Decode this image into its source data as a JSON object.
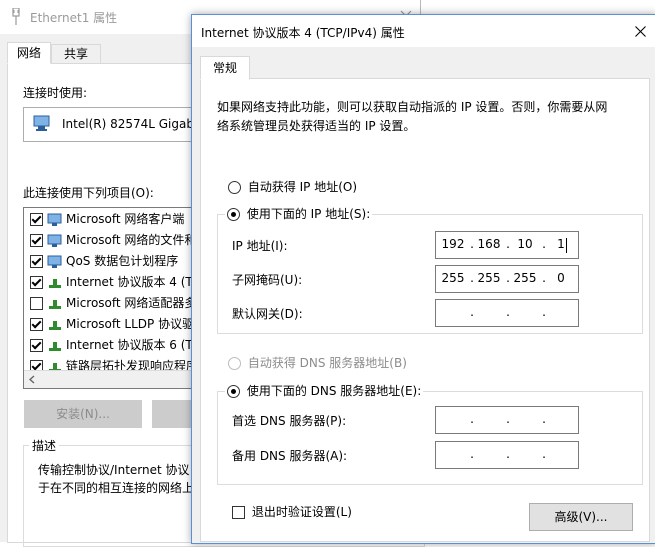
{
  "back": {
    "title": "Ethernet1 属性",
    "tabs": [
      "网络",
      "共享"
    ],
    "connect_using_label": "连接时使用:",
    "adapter_name": "Intel(R) 82574L Gigabit",
    "items_label": "此连接使用下列项目(O):",
    "items": [
      {
        "label": "Microsoft 网络客户端",
        "checked": true
      },
      {
        "label": "Microsoft 网络的文件和",
        "checked": true
      },
      {
        "label": "QoS 数据包计划程序",
        "checked": true
      },
      {
        "label": "Internet 协议版本 4 (TC",
        "checked": true
      },
      {
        "label": "Microsoft 网络适配器多",
        "checked": false
      },
      {
        "label": "Microsoft LLDP 协议驱",
        "checked": true
      },
      {
        "label": "Internet 协议版本 6 (TC",
        "checked": true
      },
      {
        "label": "链路层拓扑发现响应程序",
        "checked": true
      }
    ],
    "install_button": "安装(N)...",
    "desc_label": "描述",
    "desc_text_1": "传输控制协议/Internet 协议",
    "desc_text_2": "于在不同的相互连接的网络上"
  },
  "front": {
    "title": "Internet 协议版本 4 (TCP/IPv4) 属性",
    "tab": "常规",
    "info_1": "如果网络支持此功能，则可以获取自动指派的 IP 设置。否则，你需要从网",
    "info_2": "络系统管理员处获得适当的 IP 设置。",
    "auto_ip": "自动获得 IP 地址(O)",
    "manual_ip": "使用下面的 IP 地址(S):",
    "ip_label": "IP 地址(I):",
    "ip_value": [
      "192",
      "168",
      "10",
      "1"
    ],
    "mask_label": "子网掩码(U):",
    "mask_value": [
      "255",
      "255",
      "255",
      "0"
    ],
    "gateway_label": "默认网关(D):",
    "auto_dns": "自动获得 DNS 服务器地址(B)",
    "manual_dns": "使用下面的 DNS 服务器地址(E):",
    "dns_primary_label": "首选 DNS 服务器(P):",
    "dns_alt_label": "备用 DNS 服务器(A):",
    "validate_label": "退出时验证设置(L)",
    "advanced_button": "高级(V)..."
  }
}
